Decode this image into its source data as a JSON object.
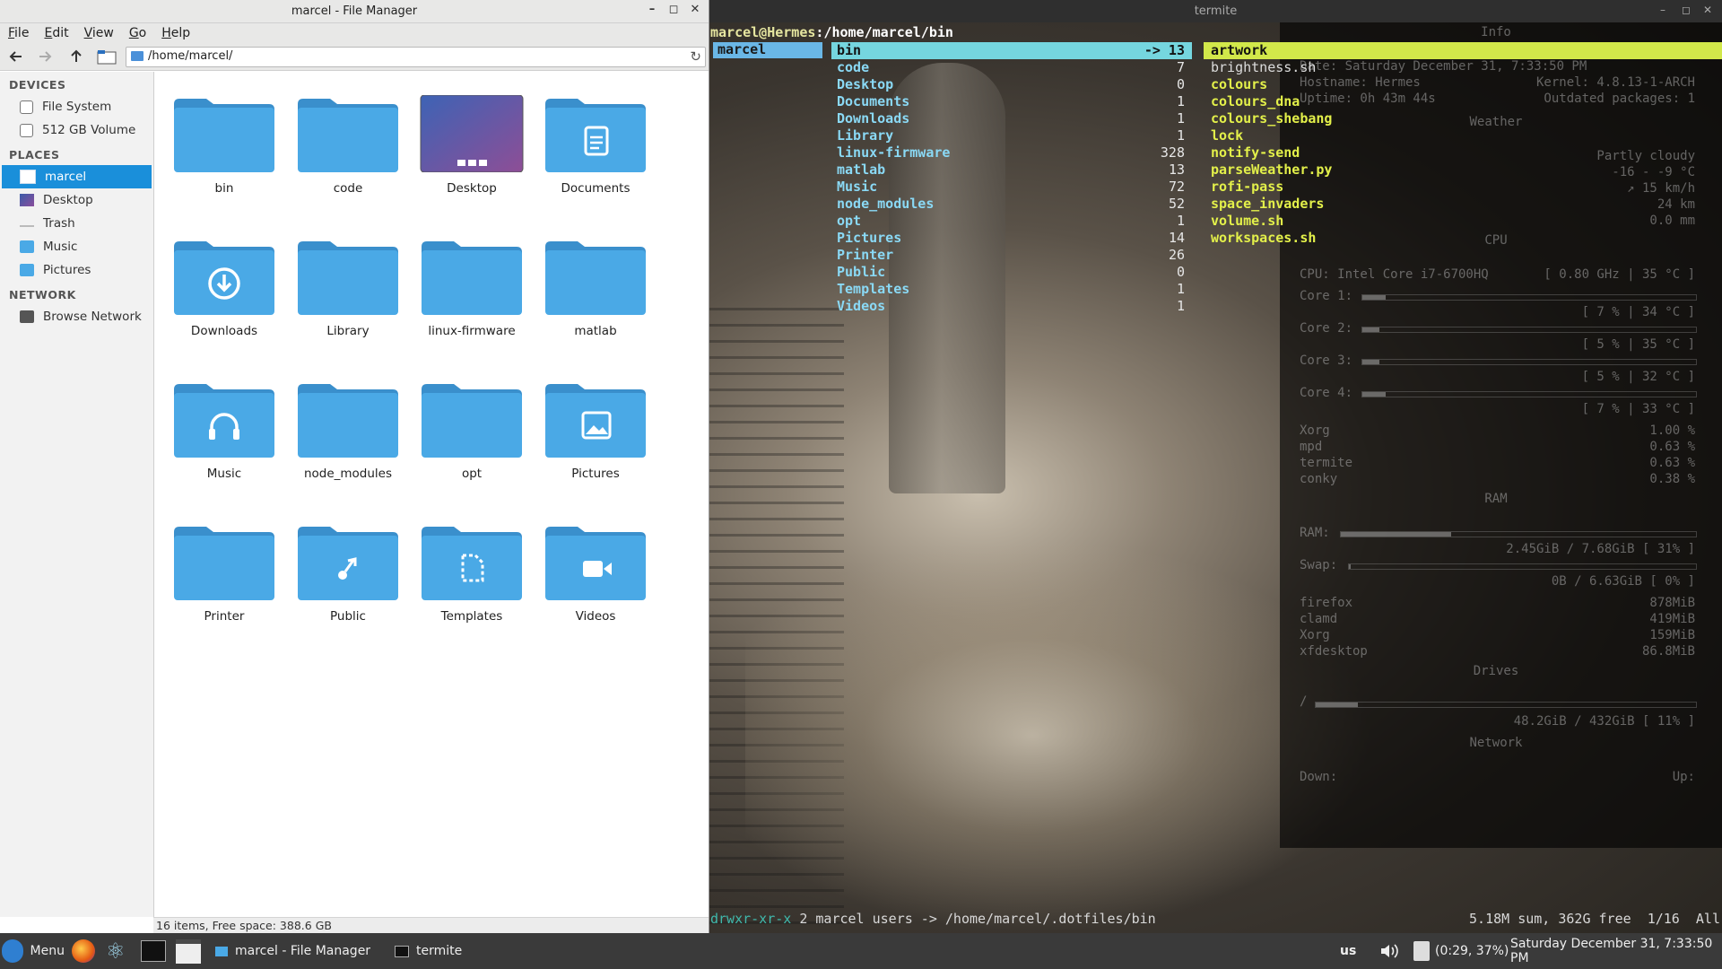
{
  "file_manager": {
    "title": "marcel - File Manager",
    "menu": [
      {
        "key": "F",
        "rest": "ile"
      },
      {
        "key": "E",
        "rest": "dit"
      },
      {
        "key": "V",
        "rest": "iew"
      },
      {
        "key": "G",
        "rest": "o"
      },
      {
        "key": "H",
        "rest": "elp"
      }
    ],
    "address": "/home/marcel/",
    "sidebar": {
      "devices_header": "DEVICES",
      "devices": [
        "File System",
        "512 GB Volume"
      ],
      "places_header": "PLACES",
      "places": [
        "marcel",
        "Desktop",
        "Trash",
        "Music",
        "Pictures"
      ],
      "network_header": "NETWORK",
      "network": [
        "Browse Network"
      ]
    },
    "items": [
      {
        "label": "bin",
        "icon": "folder-icon"
      },
      {
        "label": "code",
        "icon": "folder-icon"
      },
      {
        "label": "Desktop",
        "icon": "desktop-folder-icon"
      },
      {
        "label": "Documents",
        "icon": "documents-folder-icon"
      },
      {
        "label": "Downloads",
        "icon": "downloads-folder-icon"
      },
      {
        "label": "Library",
        "icon": "folder-icon"
      },
      {
        "label": "linux-firmware",
        "icon": "folder-icon"
      },
      {
        "label": "matlab",
        "icon": "folder-icon"
      },
      {
        "label": "Music",
        "icon": "music-folder-icon"
      },
      {
        "label": "node_modules",
        "icon": "folder-icon"
      },
      {
        "label": "opt",
        "icon": "folder-icon"
      },
      {
        "label": "Pictures",
        "icon": "pictures-folder-icon"
      },
      {
        "label": "Printer",
        "icon": "folder-icon"
      },
      {
        "label": "Public",
        "icon": "public-folder-icon"
      },
      {
        "label": "Templates",
        "icon": "templates-folder-icon"
      },
      {
        "label": "Videos",
        "icon": "videos-folder-icon"
      }
    ],
    "status": "16 items, Free space: 388.6 GB"
  },
  "terminal": {
    "title": "termite",
    "prompt_user": "marcel@Hermes",
    "prompt_path": ":/home/marcel/bin",
    "col1": "marcel",
    "col2": [
      {
        "name": "bin",
        "count": "-> 13"
      },
      {
        "name": "code",
        "count": "7"
      },
      {
        "name": "Desktop",
        "count": "0"
      },
      {
        "name": "Documents",
        "count": "1"
      },
      {
        "name": "Downloads",
        "count": "1"
      },
      {
        "name": "Library",
        "count": "1"
      },
      {
        "name": "linux-firmware",
        "count": "328"
      },
      {
        "name": "matlab",
        "count": "13"
      },
      {
        "name": "Music",
        "count": "72"
      },
      {
        "name": "node_modules",
        "count": "52"
      },
      {
        "name": "opt",
        "count": "1"
      },
      {
        "name": "Pictures",
        "count": "14"
      },
      {
        "name": "Printer",
        "count": "26"
      },
      {
        "name": "Public",
        "count": "0"
      },
      {
        "name": "Templates",
        "count": "1"
      },
      {
        "name": "Videos",
        "count": "1"
      }
    ],
    "col3": [
      {
        "name": "artwork",
        "type": "sel"
      },
      {
        "name": "brightness.sh",
        "type": "plain"
      },
      {
        "name": "colours",
        "type": "exec"
      },
      {
        "name": "colours_dna",
        "type": "exec"
      },
      {
        "name": "colours_shebang",
        "type": "exec"
      },
      {
        "name": "lock",
        "type": "exec"
      },
      {
        "name": "notify-send",
        "type": "exec"
      },
      {
        "name": "parseWeather.py",
        "type": "exec"
      },
      {
        "name": "rofi-pass",
        "type": "exec"
      },
      {
        "name": "space_invaders",
        "type": "exec"
      },
      {
        "name": "volume.sh",
        "type": "exec"
      },
      {
        "name": "workspaces.sh",
        "type": "exec"
      }
    ],
    "status_perm": "drwxr-xr-x",
    "status_info": " 2 marcel users -> /home/marcel/.dotfiles/bin",
    "status_right": "5.18M sum, 362G free  1/16  All"
  },
  "conky": {
    "info": "Info",
    "date": "Date: Saturday December 31, 7:33:50 PM",
    "hostname": "Hostname: Hermes",
    "kernel": "Kernel: 4.8.13-1-ARCH",
    "uptime": "Uptime: 0h 43m 44s",
    "outdated": "Outdated packages: 1",
    "weather": "Weather",
    "weather_desc": "Partly cloudy",
    "temp": "-16 - -9 °C",
    "wind": "↗ 15 km/h",
    "visibility": "24 km",
    "rain": "0.0 mm",
    "cpu": "CPU",
    "cpu_model": "CPU: Intel Core i7-6700HQ",
    "cpu_freq": "[ 0.80 GHz | 35 °C ]",
    "cores": [
      {
        "label": "Core 1:",
        "stats": "[ 7 % | 34 °C ]",
        "pct": 0.07
      },
      {
        "label": "Core 2:",
        "stats": "[ 5 % | 35 °C ]",
        "pct": 0.05
      },
      {
        "label": "Core 3:",
        "stats": "[ 5 % | 32 °C ]",
        "pct": 0.05
      },
      {
        "label": "Core 4:",
        "stats": "[ 7 % | 33 °C ]",
        "pct": 0.07
      }
    ],
    "procs": [
      {
        "name": "Xorg",
        "val": "1.00 %"
      },
      {
        "name": "mpd",
        "val": "0.63 %"
      },
      {
        "name": "termite",
        "val": "0.63 %"
      },
      {
        "name": "conky",
        "val": "0.38 %"
      }
    ],
    "ram": "RAM",
    "ram_label": "RAM:",
    "ram_stats": "2.45GiB / 7.68GiB [ 31% ]",
    "ram_pct": 0.31,
    "swap_label": "Swap:",
    "swap_stats": "0B / 6.63GiB [ 0% ]",
    "mem_procs": [
      {
        "name": "firefox",
        "val": "878MiB"
      },
      {
        "name": "clamd",
        "val": "419MiB"
      },
      {
        "name": "Xorg",
        "val": "159MiB"
      },
      {
        "name": "xfdesktop",
        "val": "86.8MiB"
      }
    ],
    "drives": "Drives",
    "drive_label": "/",
    "drive_stats": "48.2GiB / 432GiB [ 11% ]",
    "drive_pct": 0.11,
    "network": "Network",
    "down": "Down:",
    "up": "Up:"
  },
  "taskbar": {
    "menu": "Menu",
    "task1": "marcel - File Manager",
    "task2": "termite",
    "kb": "us",
    "battery": "(0:29, 37%)",
    "clock": "Saturday December 31, 7:33:50 PM"
  },
  "colors": {
    "folder": "#4aa9e6",
    "folder_tab": "#3a8fcc",
    "selection": "#1a8fda"
  }
}
